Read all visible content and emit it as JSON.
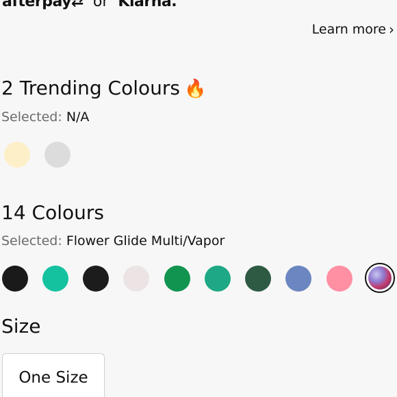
{
  "payment": {
    "afterpay_label": "afterpay",
    "afterpay_mark": "⇄",
    "or_text": "or",
    "klarna_label": "Klarna."
  },
  "learn_more": {
    "label": "Learn more",
    "chevron": "›"
  },
  "trending": {
    "title": "2 Trending Colours",
    "emoji": "🔥",
    "selected_label": "Selected:",
    "selected_value": "N/A",
    "swatches": [
      {
        "color": "#fdf0c9",
        "name": "cream"
      },
      {
        "color": "#dcdcdc",
        "name": "light-grey"
      }
    ]
  },
  "colours": {
    "title": "14 Colours",
    "selected_label": "Selected:",
    "selected_value": "Flower Glide Multi/Vapor",
    "swatches": [
      {
        "color": "#1a1a1a",
        "name": "black-1"
      },
      {
        "color": "#14c2a0",
        "name": "teal"
      },
      {
        "color": "#1c1c1c",
        "name": "black-2"
      },
      {
        "color": "#ece4e4",
        "name": "pale-pink"
      },
      {
        "color": "#11944f",
        "name": "green"
      },
      {
        "color": "#1ea885",
        "name": "green-teal"
      },
      {
        "color": "#2e5a44",
        "name": "dark-green"
      },
      {
        "color": "#6b86c0",
        "name": "periwinkle"
      },
      {
        "color": "#ff8fa3",
        "name": "pink"
      },
      {
        "color": "#8e7ad0",
        "name": "flower-glide-multi-vapor",
        "selected": true
      }
    ]
  },
  "size": {
    "title": "Size",
    "option_label": "One Size"
  }
}
